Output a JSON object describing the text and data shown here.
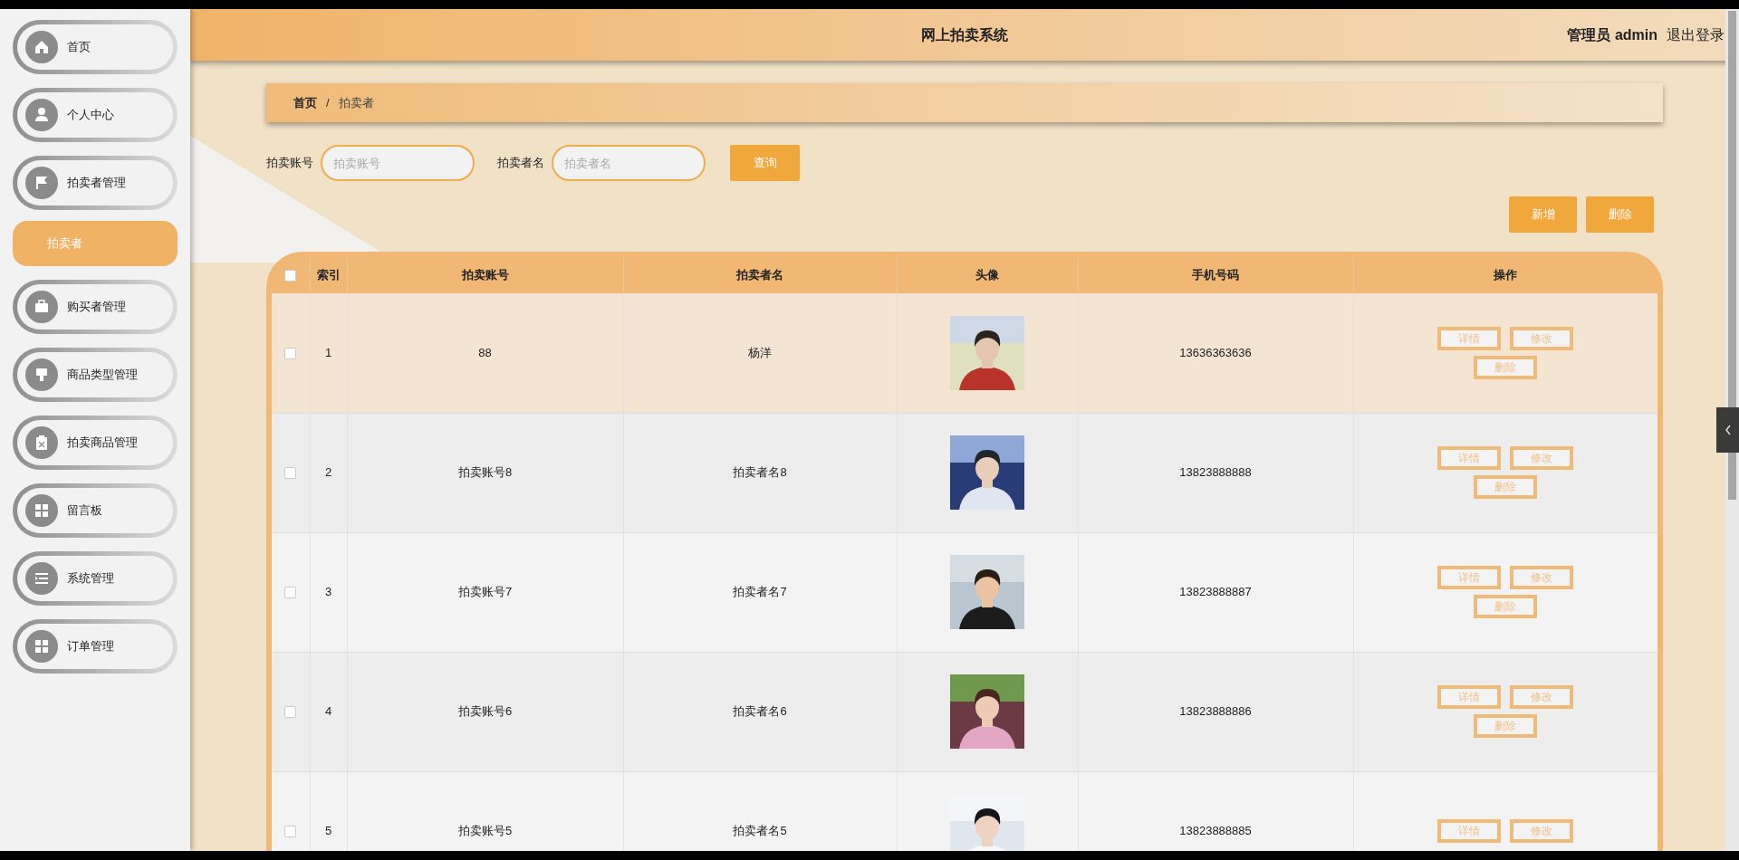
{
  "sidebar": {
    "items": [
      {
        "label": "首页"
      },
      {
        "label": "个人中心"
      },
      {
        "label": "拍卖者管理",
        "children": [
          {
            "label": "拍卖者",
            "selected": true
          }
        ]
      },
      {
        "label": "购买者管理"
      },
      {
        "label": "商品类型管理"
      },
      {
        "label": "拍卖商品管理"
      },
      {
        "label": "留言板"
      },
      {
        "label": "系统管理"
      },
      {
        "label": "订单管理"
      }
    ]
  },
  "header": {
    "title": "网上拍卖系统",
    "user": "管理员 admin",
    "logout": "退出登录"
  },
  "breadcrumb": [
    {
      "label": "首页",
      "current": false
    },
    {
      "label": "拍卖者",
      "current": true
    }
  ],
  "breadcrumb_separator": "/",
  "filters": [
    {
      "label": "拍卖账号",
      "placeholder": "拍卖账号"
    },
    {
      "label": "拍卖者名",
      "placeholder": "拍卖者名"
    }
  ],
  "search_button": "查询",
  "toolbar_buttons": [
    "新增",
    "删除"
  ],
  "table": {
    "select_all": {
      "checked": false
    },
    "columns": [
      "索引",
      "拍卖账号",
      "拍卖者名",
      "头像",
      "手机号码",
      "操作"
    ],
    "rows": [
      {
        "index": "1",
        "account": "88",
        "name": "杨洋",
        "avatar": {
          "kind": "picture"
        },
        "phone": "13636363636",
        "highlighted": true,
        "checked": false,
        "actions": [
          [
            "详情",
            "修改"
          ],
          [
            "删除"
          ]
        ]
      },
      {
        "index": "2",
        "account": "拍卖账号8",
        "name": "拍卖者名8",
        "avatar": {
          "kind": "picture"
        },
        "phone": "13823888888",
        "highlighted": false,
        "checked": false,
        "actions": [
          [
            "详情",
            "修改"
          ],
          [
            "删除"
          ]
        ]
      },
      {
        "index": "3",
        "account": "拍卖账号7",
        "name": "拍卖者名7",
        "avatar": {
          "kind": "picture"
        },
        "phone": "13823888887",
        "highlighted": false,
        "checked": false,
        "actions": [
          [
            "详情",
            "修改"
          ],
          [
            "删除"
          ]
        ]
      },
      {
        "index": "4",
        "account": "拍卖账号6",
        "name": "拍卖者名6",
        "avatar": {
          "kind": "picture"
        },
        "phone": "13823888886",
        "highlighted": false,
        "checked": false,
        "actions": [
          [
            "详情",
            "修改"
          ],
          [
            "删除"
          ]
        ]
      },
      {
        "index": "5",
        "account": "拍卖账号5",
        "name": "拍卖者名5",
        "avatar": {
          "kind": "picture"
        },
        "phone": "13823888885",
        "highlighted": false,
        "checked": false,
        "actions": [
          [
            "详情",
            "修改"
          ]
        ]
      }
    ]
  }
}
